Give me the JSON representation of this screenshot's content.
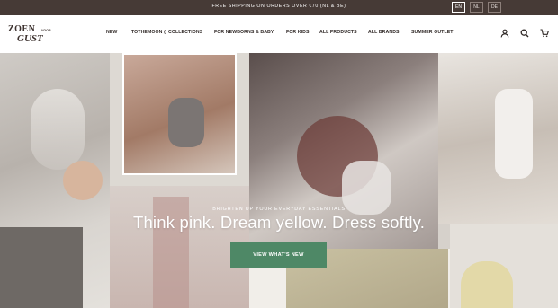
{
  "announcement": {
    "text": "FREE SHIPPING ON ORDERS OVER €70 (NL & BE)"
  },
  "languages": [
    {
      "label": "EN",
      "active": true
    },
    {
      "label": "NL",
      "active": false
    },
    {
      "label": "DE",
      "active": false
    }
  ],
  "logo": {
    "line1": "ZOEN",
    "small": "VOOR",
    "line2": "GUST"
  },
  "nav": [
    {
      "label": "NEW"
    },
    {
      "label": "TOTHEMOON ("
    },
    {
      "label": "COLLECTIONS"
    },
    {
      "label": "FOR NEWBORNS & BABY"
    },
    {
      "label": "FOR KIDS"
    },
    {
      "label": "ALL PRODUCTS"
    },
    {
      "label": "ALL BRANDS"
    },
    {
      "label": "SUMMER OUTLET"
    }
  ],
  "icons": {
    "account": "user-icon",
    "search": "search-icon",
    "cart": "cart-icon"
  },
  "hero": {
    "eyebrow": "BRIGHTEN UP YOUR EVERYDAY ESSENTIALS",
    "headline": "Think pink. Dream yellow. Dress softly.",
    "cta": "VIEW WHAT'S NEW"
  },
  "colors": {
    "topbar": "#463a36",
    "cta": "#4e8866",
    "text": "#2f2826"
  }
}
